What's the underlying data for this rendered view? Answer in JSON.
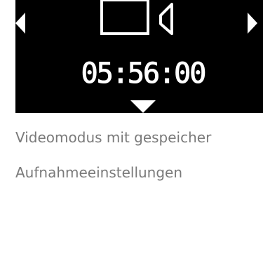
{
  "screen": {
    "timer": "05:56:00",
    "icons": {
      "left": "arrow-left-icon",
      "right": "arrow-right-icon",
      "mode": "video-camera-icon",
      "down": "arrow-down-icon"
    },
    "colors": {
      "background": "#000000",
      "foreground": "#ffffff"
    }
  },
  "caption": {
    "line1": "Videomodus mit gespeicher",
    "line2": "Aufnahmeeinstellungen"
  },
  "colors": {
    "caption_text": "#7a7a7a"
  }
}
